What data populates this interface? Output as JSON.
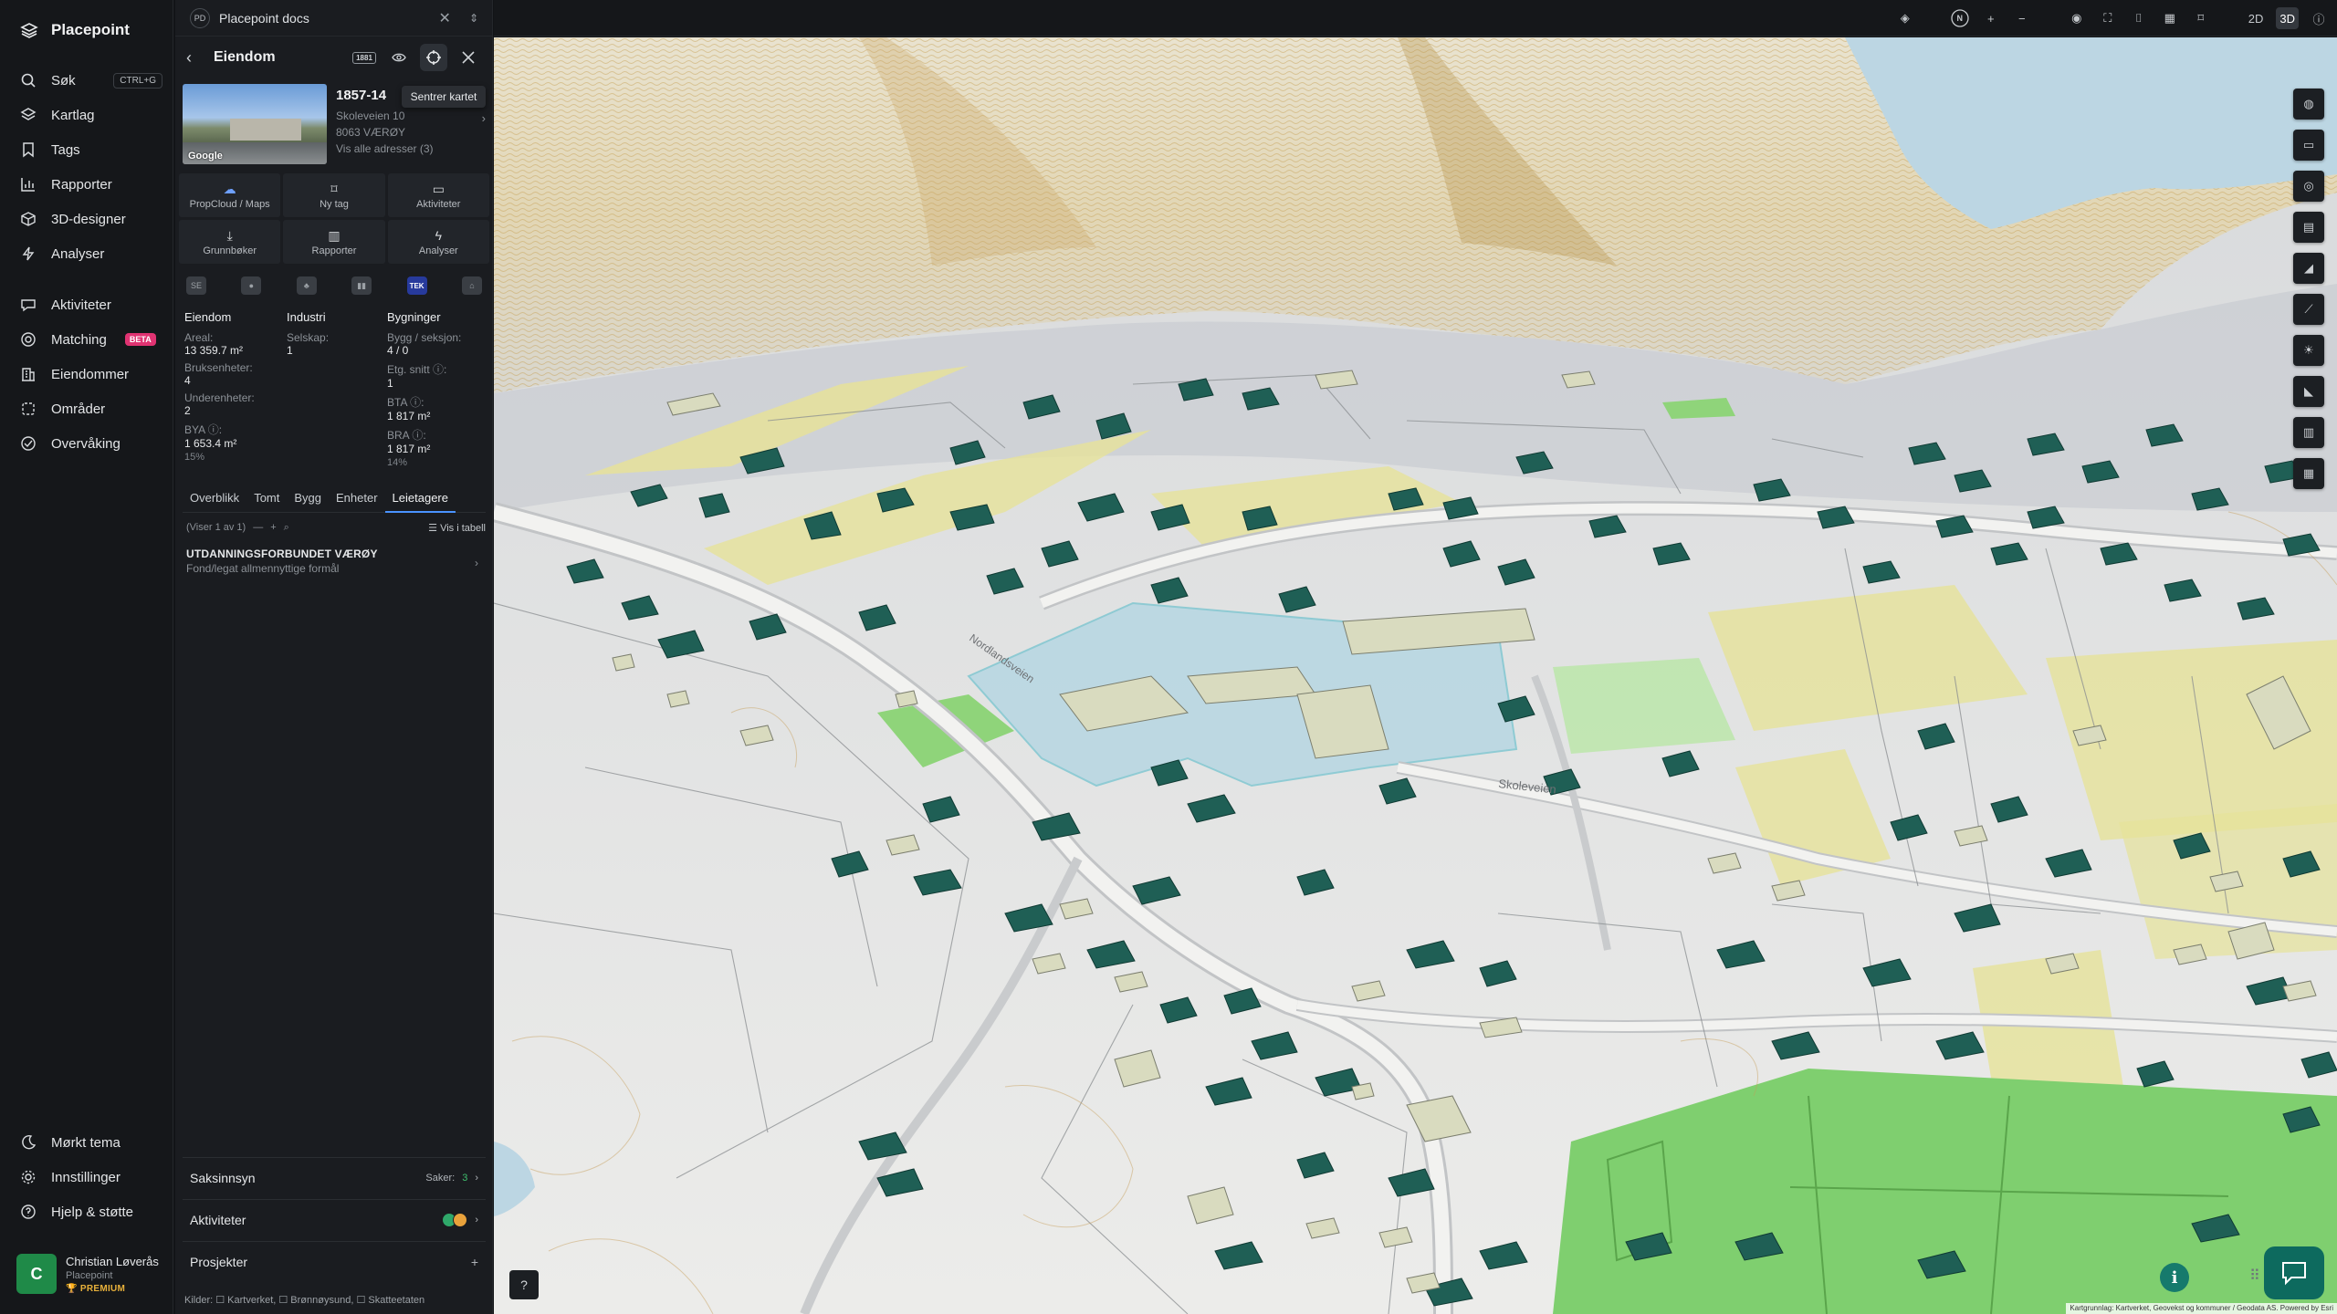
{
  "nav": {
    "brand": "Placepoint",
    "items": [
      {
        "label": "Søk",
        "icon": "search-icon",
        "shortcut": "CTRL+G"
      },
      {
        "label": "Kartlag",
        "icon": "layers-icon"
      },
      {
        "label": "Tags",
        "icon": "bookmark-icon"
      },
      {
        "label": "Rapporter",
        "icon": "bar-chart-icon"
      },
      {
        "label": "3D-designer",
        "icon": "cube-icon"
      },
      {
        "label": "Analyser",
        "icon": "bolt-icon"
      },
      {
        "label": "Aktiviteter",
        "icon": "chat-icon"
      },
      {
        "label": "Matching",
        "icon": "target-icon",
        "badge": "BETA"
      },
      {
        "label": "Eiendommer",
        "icon": "building-icon"
      },
      {
        "label": "Områder",
        "icon": "area-icon"
      },
      {
        "label": "Overvåking",
        "icon": "monitor-icon"
      }
    ],
    "bottom": [
      {
        "label": "Mørkt tema",
        "icon": "moon-icon"
      },
      {
        "label": "Innstillinger",
        "icon": "gear-icon"
      },
      {
        "label": "Hjelp & støtte",
        "icon": "help-icon"
      }
    ],
    "user": {
      "initial": "C",
      "name": "Christian Løverås",
      "org": "Placepoint",
      "plan": "PREMIUM"
    }
  },
  "docbar": {
    "badge": "PD",
    "title": "Placepoint docs"
  },
  "panel": {
    "title": "Eiendom",
    "badge": "1881",
    "tooltip": "Sentrer kartet",
    "property": {
      "id": "1857-14",
      "street": "Skoleveien 10",
      "postal": "8063 VÆRØY",
      "all_addresses": "Vis alle adresser (3)",
      "photo_label": "Google"
    },
    "actions": [
      {
        "label": "PropCloud / Maps",
        "icon": "cloud-icon"
      },
      {
        "label": "Ny tag",
        "icon": "bookmark-icon"
      },
      {
        "label": "Aktiviteter",
        "icon": "chat-icon"
      },
      {
        "label": "Grunnbøker",
        "icon": "download-icon"
      },
      {
        "label": "Rapporter",
        "icon": "bar-chart-icon"
      },
      {
        "label": "Analyser",
        "icon": "bolt-icon"
      }
    ],
    "strip": [
      "SE",
      "●",
      "♣",
      "▮▮",
      "TEK",
      "⌂"
    ],
    "stats": {
      "eiendom": {
        "title": "Eiendom",
        "areal_label": "Areal:",
        "areal": "13 359.7 m²",
        "bruksenheter_label": "Bruksenheter:",
        "bruksenheter": "4",
        "underenheter_label": "Underenheter:",
        "underenheter": "2",
        "bya_label": "BYA ⓘ:",
        "bya": "1 653.4 m²",
        "bya_pct": "15%"
      },
      "industri": {
        "title": "Industri",
        "selskap_label": "Selskap:",
        "selskap": "1"
      },
      "bygninger": {
        "title": "Bygninger",
        "bygg_label": "Bygg / seksjon:",
        "bygg": "4 / 0",
        "etg_label": "Etg. snitt ⓘ:",
        "etg": "1",
        "bta_label": "BTA ⓘ:",
        "bta": "1 817 m²",
        "bra_label": "BRA ⓘ:",
        "bra": "1 817 m²",
        "bra_pct": "14%"
      }
    },
    "tabs": [
      "Overblikk",
      "Tomt",
      "Bygg",
      "Enheter",
      "Leietagere"
    ],
    "active_tab": "Leietagere",
    "list": {
      "count": "(Viser 1 av 1)",
      "table": "Vis i tabell"
    },
    "tenant": {
      "name": "UTDANNINGSFORBUNDET VÆRØY",
      "type": "Fond/legat allmennyttige formål"
    },
    "sections": {
      "saksinnsyn": "Saksinnsyn",
      "saker_label": "Saker:",
      "saker": "3",
      "aktiviteter": "Aktiviteter",
      "prosjekter": "Prosjekter"
    },
    "sources": "Kilder: ☐ Kartverket, ☐ Brønnøysund, ☐ Skatteetaten"
  },
  "topbar": {
    "compass": "N",
    "mode_2d": "2D",
    "mode_3d": "3D",
    "active_mode": "3D"
  },
  "map": {
    "attribution": "Kartgrunnlag: Kartverket, Geovekst og kommuner / Geodata AS. Powered by Esri",
    "road_label_1": "Skoleveien",
    "road_label_2": "Nordlandsveien"
  },
  "colors": {
    "building": "#1f5f55",
    "accent": "#4a93ff",
    "field": "#7fcf6f",
    "farmland": "#e6e29a"
  }
}
